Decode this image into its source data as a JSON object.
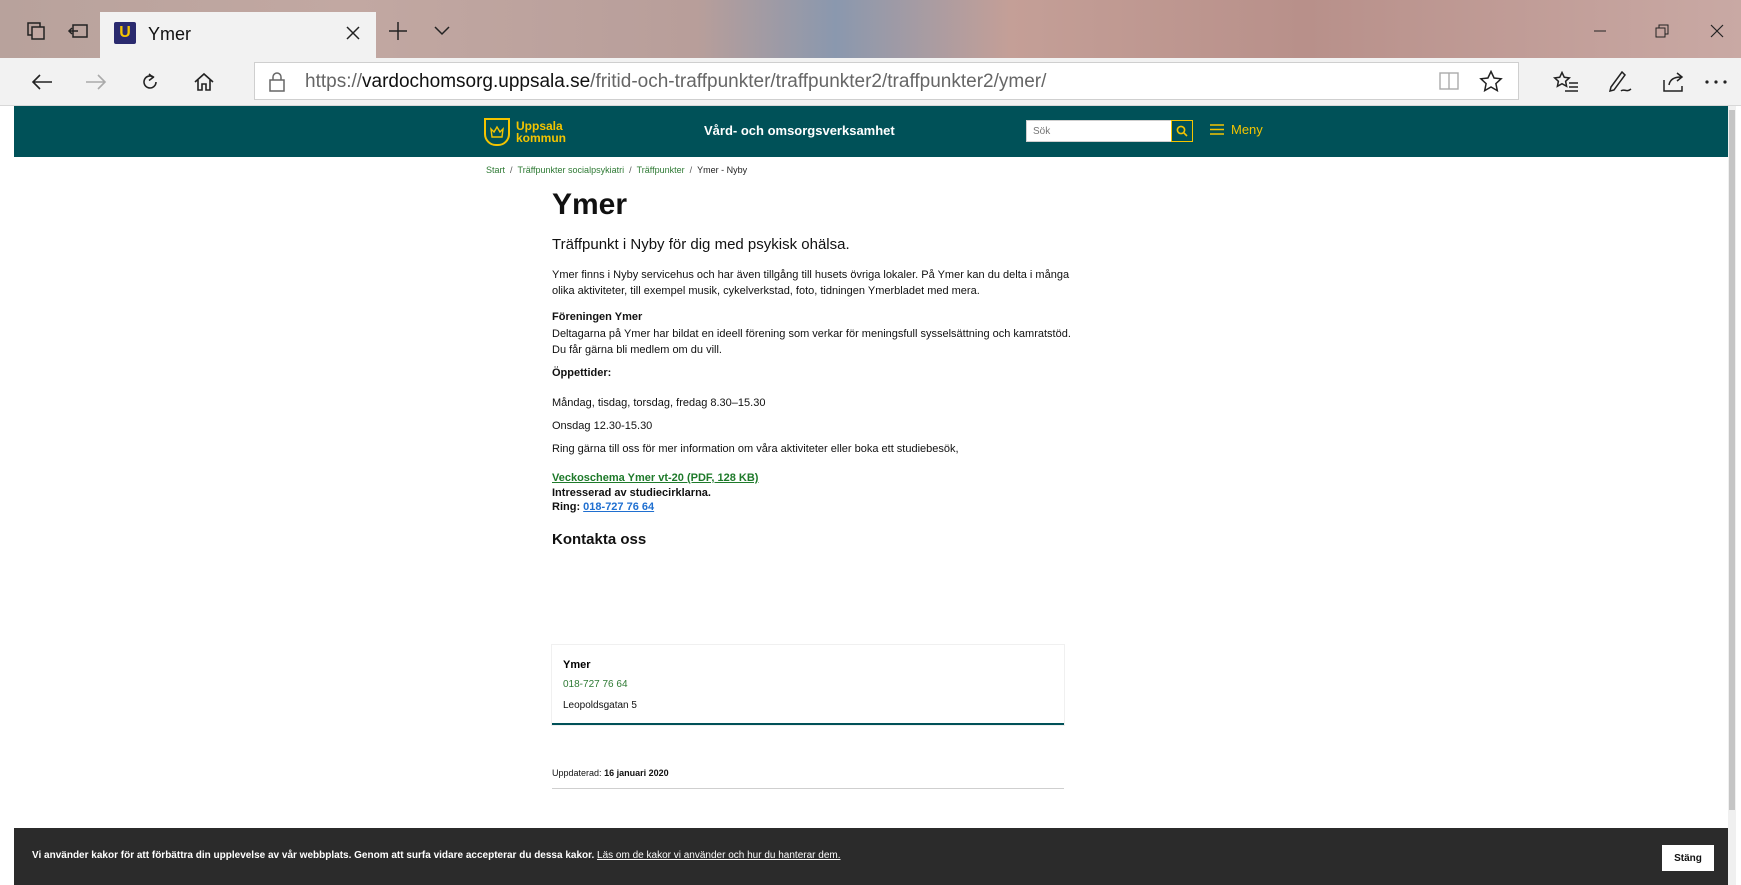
{
  "browser": {
    "tab_title": "Ymer",
    "favicon_letter": "U",
    "url_prefix": "https://",
    "url_domain": "vardochomsorg.uppsala.se",
    "url_path": "/fritid-och-traffpunkter/traffpunkter2/traffpunkter2/ymer/"
  },
  "header": {
    "logo_line1": "Uppsala",
    "logo_line2": "kommun",
    "site_name": "Vård- och omsorgsverksamhet",
    "search_placeholder": "Sök",
    "menu_label": "Meny"
  },
  "breadcrumb": {
    "items": [
      "Start",
      "Träffpunkter socialpsykiatri",
      "Träffpunkter"
    ],
    "current": "Ymer - Nyby",
    "separator": "/"
  },
  "article": {
    "title": "Ymer",
    "lead": "Träffpunkt i Nyby för dig med psykisk ohälsa.",
    "intro": "Ymer finns i Nyby servicehus och har även tillgång till husets övriga lokaler. På Ymer kan du delta i många olika aktiviteter, till exempel musik, cykelverkstad, foto, tidningen Ymerbladet med mera.",
    "assoc_heading": "Föreningen Ymer",
    "assoc_text": "Deltagarna på Ymer har bildat en ideell förening som verkar för meningsfull sysselsättning och kamratstöd.",
    "assoc_member": "Du får gärna bli medlem om du vill.",
    "hours_heading": "Öppettider:",
    "hours_1": "Måndag, tisdag, torsdag, fredag 8.30–15.30",
    "hours_2": "Onsdag 12.30-15.30",
    "call_text": "Ring gärna till oss för mer information om våra aktiviteter eller boka ett studiebesök,",
    "schedule_link": "Veckoschema Ymer vt-20 (PDF, 128 KB)",
    "study_circles": "Intresserad av studiecirklarna.",
    "ring_label": "Ring:",
    "ring_phone": "018-727 76 64"
  },
  "contact": {
    "heading": "Kontakta oss",
    "name": "Ymer",
    "phone": "018-727 76 64",
    "address": "Leopoldsgatan 5"
  },
  "updated": {
    "label": "Uppdaterad:",
    "date": "16 januari 2020"
  },
  "cookie": {
    "text": "Vi använder kakor för att förbättra din upplevelse av vår webbplats. Genom att surfa vidare accepterar du dessa kakor.",
    "link": "Läs om de kakor vi använder och hur du hanterar dem.",
    "close_label": "Stäng"
  },
  "colors": {
    "brand_teal": "#005158",
    "brand_yellow": "#f4c400",
    "link_green": "#2e7a34",
    "link_blue": "#1f6fd0"
  }
}
